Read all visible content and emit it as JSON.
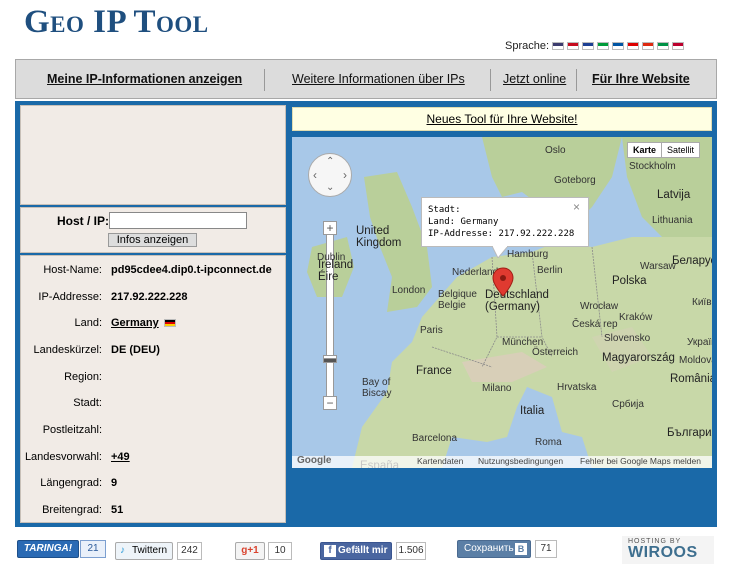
{
  "site": {
    "logo": "Geo IP Tool"
  },
  "languages": {
    "label": "Sprache:",
    "flags": [
      {
        "name": "flag-usa-icon",
        "color": "#3c3b6e"
      },
      {
        "name": "flag-spain-icon",
        "color": "#c60b1e"
      },
      {
        "name": "flag-russia-icon",
        "color": "#1c3f94"
      },
      {
        "name": "flag-brazil-icon",
        "color": "#009b3a"
      },
      {
        "name": "flag-france-icon",
        "color": "#0055a4"
      },
      {
        "name": "flag-germany-icon",
        "color": "#dd0000"
      },
      {
        "name": "flag-china-icon",
        "color": "#de2910"
      },
      {
        "name": "flag-italy-icon",
        "color": "#009246"
      },
      {
        "name": "flag-japan-icon",
        "color": "#bc002d"
      }
    ]
  },
  "nav": {
    "my_ip": "Meine IP-Informationen anzeigen",
    "more_info": "Weitere Informationen über IPs",
    "online": "Jetzt online",
    "website": "Für Ihre Website"
  },
  "form": {
    "label": "Host / IP:",
    "value": "",
    "button": "Infos anzeigen"
  },
  "info": [
    {
      "key": "Host-Name:",
      "value": "pd95cdee4.dip0.t-ipconnect.de"
    },
    {
      "key": "IP-Addresse:",
      "value": "217.92.222.228"
    },
    {
      "key": "Land:",
      "value": "Germany"
    },
    {
      "key": "Landeskürzel:",
      "value": "DE (DEU)"
    },
    {
      "key": "Region:",
      "value": ""
    },
    {
      "key": "Stadt:",
      "value": ""
    },
    {
      "key": "Postleitzahl:",
      "value": ""
    },
    {
      "key": "Landesvorwahl:",
      "value": "+49"
    },
    {
      "key": "Längengrad:",
      "value": "9"
    },
    {
      "key": "Breitengrad:",
      "value": "51"
    }
  ],
  "new_tool": "Neues Tool für Ihre Website!",
  "map": {
    "type_map": "Karte",
    "type_satellite": "Satellit",
    "popup": {
      "city": "Stadt:",
      "country": "Land: Germany",
      "ip": "IP-Addresse: 217.92.222.228",
      "close": "×"
    },
    "labels": {
      "oslo": "Oslo",
      "stockholm": "Stockholm",
      "goteborg": "Goteborg",
      "latvija": "Latvija",
      "lithuania": "Lithuania",
      "united_kingdom": "United\nKingdom",
      "ireland": "Ireland\nÉire",
      "dublin": "Dublin",
      "london": "London",
      "nederland": "Nederland",
      "hamburg": "Hamburg",
      "berlin": "Berlin",
      "polska": "Polska",
      "belarus": "Беларус",
      "belgique": "Belgique\nBelgie",
      "deutschland": "Deutschland\n(Germany)",
      "warsaw": "Warsaw",
      "kyiv": "Київ",
      "wroclaw": "Wrocław",
      "cesko": "Česká rep",
      "krakow": "Kraków",
      "paris": "Paris",
      "munchen": "München",
      "ukraine": "Україн",
      "osterreich": "Österreich",
      "slovensko": "Slovensko",
      "magyarorszag": "Magyarország",
      "moldova": "Moldova",
      "france": "France",
      "bay": "Bay of\nBiscay",
      "milano": "Milano",
      "hrvatska": "Hrvatska",
      "romania": "România",
      "srbija": "Србија",
      "italia": "Italia",
      "balgaria": "България",
      "barcelona": "Barcelona",
      "roma": "Roma",
      "espana": "España"
    },
    "footer": {
      "google": "Google",
      "data": "Kartendaten",
      "terms": "Nutzungsbedingungen",
      "error": "Fehler bei Google Maps melden"
    }
  },
  "social": {
    "taringa": "TARINGA!",
    "taringa_count": "21",
    "twitter": "Twittern",
    "twitter_count": "242",
    "gplus": "g+1",
    "gplus_count": "10",
    "facebook": "Gefällt mir",
    "facebook_count": "1.506",
    "vk": "Сохранить",
    "vk_count": "71",
    "hosting_small": "HOSTING BY",
    "hosting_big": "WIROOS"
  },
  "colors": {
    "brand": "#1f4f7f",
    "panel_blue": "#1a69a8",
    "panel_bg": "#f1ebe6",
    "marker": "#e03a30"
  }
}
